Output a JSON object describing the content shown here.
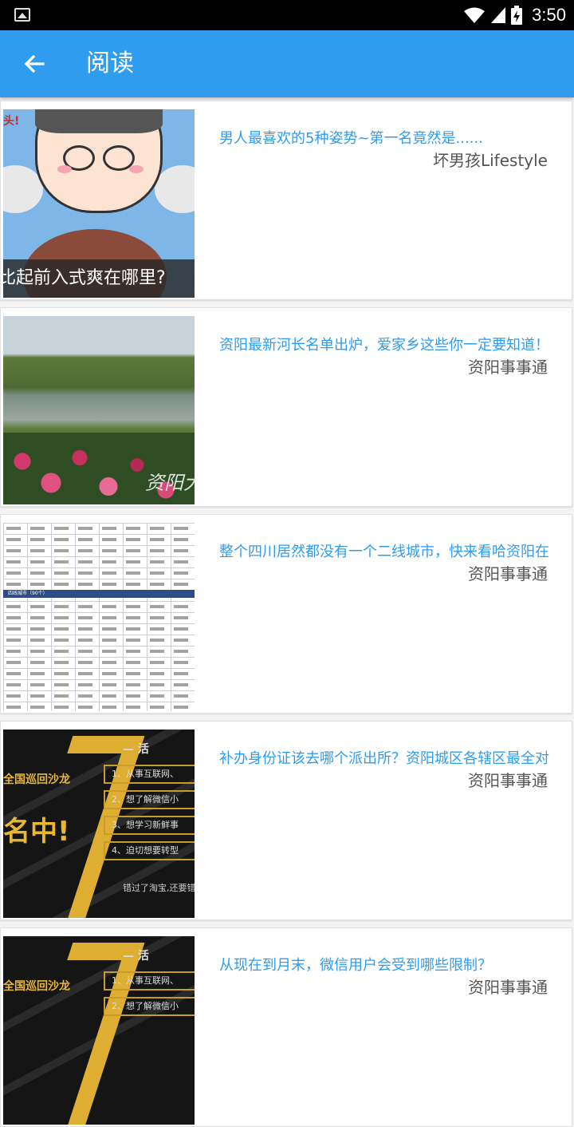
{
  "status_bar": {
    "time": "3:50"
  },
  "app_bar": {
    "title": "阅读"
  },
  "articles": [
    {
      "headline": "男人最喜欢的5种姿势~第一名竟然是......",
      "source": "坏男孩Lifestyle",
      "thumb_caption": "比起前入式爽在哪里?",
      "thumb_corner": "头!"
    },
    {
      "headline": "资阳最新河长名单出炉，爱家乡这些你一定要知道！",
      "source": "资阳事事通",
      "thumb_watermark": "资阳大"
    },
    {
      "headline": "整个四川居然都没有一个二线城市，快来看哈资阳在",
      "source": "资阳事事通",
      "thumb_band": "四线城市（90个）"
    },
    {
      "headline": "补办身份证该去哪个派出所？资阳城区各辖区最全对",
      "source": "资阳事事通",
      "thumb_text": {
        "top": "— 活",
        "salon": "全国巡回沙龙",
        "slogan": "名中!",
        "items": [
          "1、从事互联网、",
          "2、想了解微信小",
          "3、想学习新鲜事",
          "4、迫切想要转型"
        ],
        "bottom": "错过了淘宝,还要错过"
      }
    },
    {
      "headline": "从现在到月末，微信用户会受到哪些限制？",
      "source": "资阳事事通",
      "thumb_text": {
        "top": "— 活",
        "salon": "全国巡回沙龙",
        "items": [
          "1、从事互联网、",
          "2、想了解微信小"
        ]
      }
    }
  ]
}
